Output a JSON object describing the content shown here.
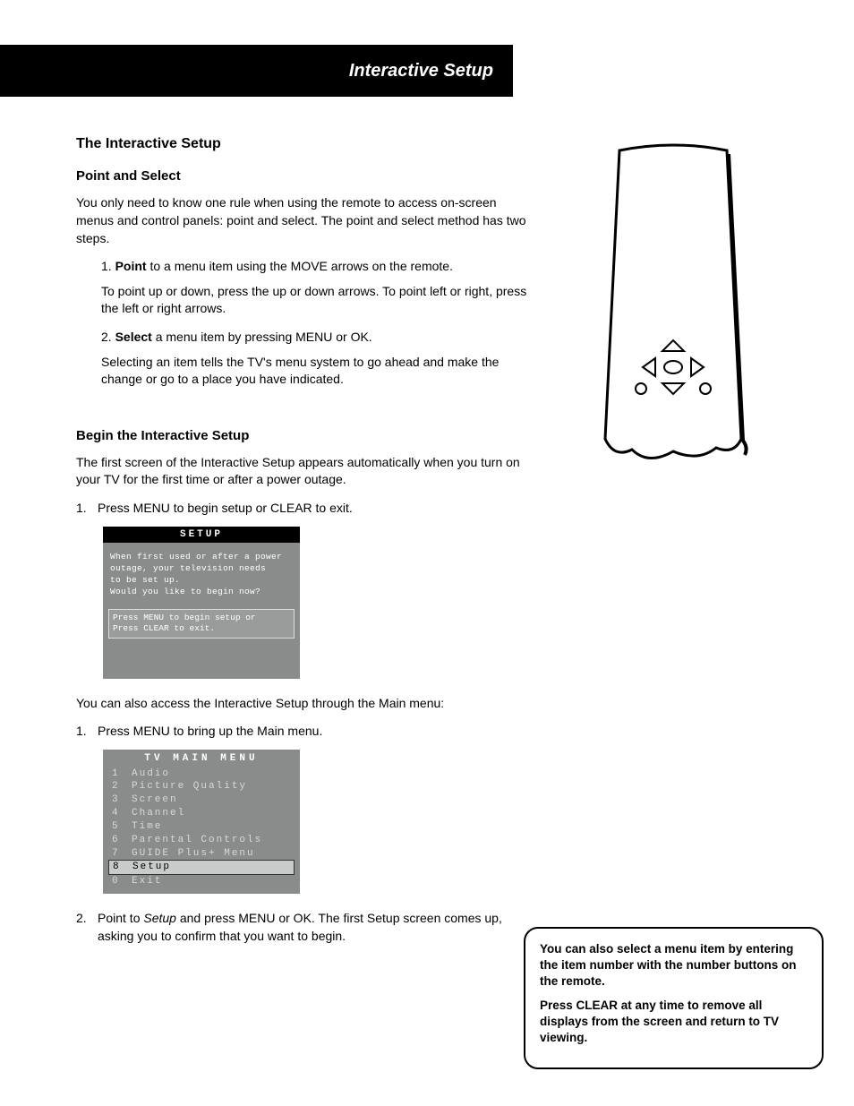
{
  "header": {
    "bar_title": "Interactive Setup"
  },
  "section1": {
    "title": "The Interactive Setup",
    "heading": "Point and Select",
    "intro": "You only need to know one rule when using the remote to access on-screen menus and control panels: point and select. The point and select method has two steps.",
    "step1_prefix": "1.",
    "step1_bold": "Point",
    "step1_rest": " to a menu item using the MOVE arrows on the remote.",
    "step1_detail": "To point up or down, press the up or down arrows. To point left or right, press the left or right arrows.",
    "step2_prefix": "2.",
    "step2_bold": "Select",
    "step2_rest": " a menu item by pressing MENU or OK.",
    "step2_detail": "Selecting an item tells the TV's menu system to go ahead and make the change or go to a place you have indicated."
  },
  "section2": {
    "heading": "Begin the Interactive Setup",
    "intro": "The first screen of the Interactive Setup appears automatically when you turn on your TV for the first time or after a power outage.",
    "step1_num": "1.",
    "step1_text": "Press MENU to begin setup or CLEAR to exit."
  },
  "setup_screen": {
    "title": "SETUP",
    "body_l1": "When first used or after a power",
    "body_l2": "outage, your television needs",
    "body_l3": "to be set up.",
    "body_l4": "Would you like to begin now?",
    "prompt_l1": "Press MENU to begin setup or",
    "prompt_l2": "Press CLEAR to exit."
  },
  "section3": {
    "intro": "You can also access the Interactive Setup through the Main menu:",
    "step1_num": "1.",
    "step1_text": "Press MENU to bring up the Main menu."
  },
  "main_menu": {
    "title": "TV MAIN MENU",
    "items": [
      {
        "num": "1",
        "label": "Audio"
      },
      {
        "num": "2",
        "label": "Picture Quality"
      },
      {
        "num": "3",
        "label": "Screen"
      },
      {
        "num": "4",
        "label": "Channel"
      },
      {
        "num": "5",
        "label": "Time"
      },
      {
        "num": "6",
        "label": "Parental Controls"
      },
      {
        "num": "7",
        "label": "GUIDE Plus+ Menu"
      },
      {
        "num": "8",
        "label": "Setup"
      },
      {
        "num": "0",
        "label": "Exit"
      }
    ]
  },
  "section4": {
    "step2_num": "2.",
    "step2_a": "Point to ",
    "step2_italic": "Setup",
    "step2_b": " and press MENU or OK. The first Setup screen comes up, asking you to confirm that you want to begin."
  },
  "tip": {
    "p1": "You can also select a menu item by entering the item number with the number buttons on the remote.",
    "p2": "Press CLEAR at any time to remove all displays from the screen and return to TV viewing."
  }
}
